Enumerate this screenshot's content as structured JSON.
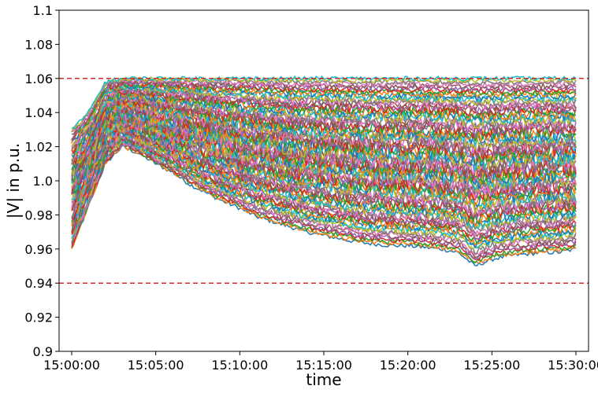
{
  "chart_data": {
    "type": "line",
    "title": "",
    "xlabel": "time",
    "ylabel": "|V| in p.u.",
    "ylim": [
      0.9,
      1.1
    ],
    "xlim": [
      "14:59:15",
      "15:30:45"
    ],
    "x_ticks": [
      "15:00:00",
      "15:05:00",
      "15:10:00",
      "15:15:00",
      "15:20:00",
      "15:25:00",
      "15:30:00"
    ],
    "y_ticks": [
      "0.9",
      "0.92",
      "0.94",
      "0.96",
      "0.98",
      "1.0",
      "1.02",
      "1.04",
      "1.06",
      "1.08",
      "1.1"
    ],
    "grid": false,
    "legend": "none",
    "reference_lines": [
      {
        "y": 1.06,
        "color": "#d62728",
        "style": "dashed"
      },
      {
        "y": 0.94,
        "color": "#d62728",
        "style": "dashed"
      }
    ],
    "palette": [
      "#1f77b4",
      "#ff7f0e",
      "#2ca02c",
      "#d62728",
      "#9467bd",
      "#8c564b",
      "#e377c2",
      "#7f7f7f",
      "#bcbd22",
      "#17becf"
    ],
    "series_count": 90,
    "x": [
      "15:00:00",
      "15:01:00",
      "15:02:00",
      "15:03:00",
      "15:04:00",
      "15:05:00",
      "15:06:00",
      "15:07:00",
      "15:08:00",
      "15:09:00",
      "15:10:00",
      "15:11:00",
      "15:12:00",
      "15:13:00",
      "15:14:00",
      "15:15:00",
      "15:16:00",
      "15:17:00",
      "15:18:00",
      "15:19:00",
      "15:20:00",
      "15:21:00",
      "15:22:00",
      "15:23:00",
      "15:24:00",
      "15:25:00",
      "15:26:00",
      "15:27:00",
      "15:28:00",
      "15:29:00",
      "15:30:00"
    ],
    "envelope": {
      "upper": [
        1.03,
        1.04,
        1.058,
        1.06,
        1.06,
        1.06,
        1.06,
        1.06,
        1.06,
        1.06,
        1.06,
        1.06,
        1.06,
        1.06,
        1.06,
        1.06,
        1.06,
        1.06,
        1.06,
        1.06,
        1.06,
        1.06,
        1.06,
        1.06,
        1.06,
        1.06,
        1.06,
        1.06,
        1.06,
        1.06,
        1.06
      ],
      "lower": [
        0.96,
        0.985,
        1.01,
        1.02,
        1.016,
        1.01,
        1.005,
        0.998,
        0.993,
        0.988,
        0.984,
        0.979,
        0.976,
        0.973,
        0.97,
        0.968,
        0.966,
        0.964,
        0.963,
        0.962,
        0.962,
        0.961,
        0.96,
        0.958,
        0.95,
        0.954,
        0.956,
        0.957,
        0.958,
        0.958,
        0.96
      ]
    }
  }
}
